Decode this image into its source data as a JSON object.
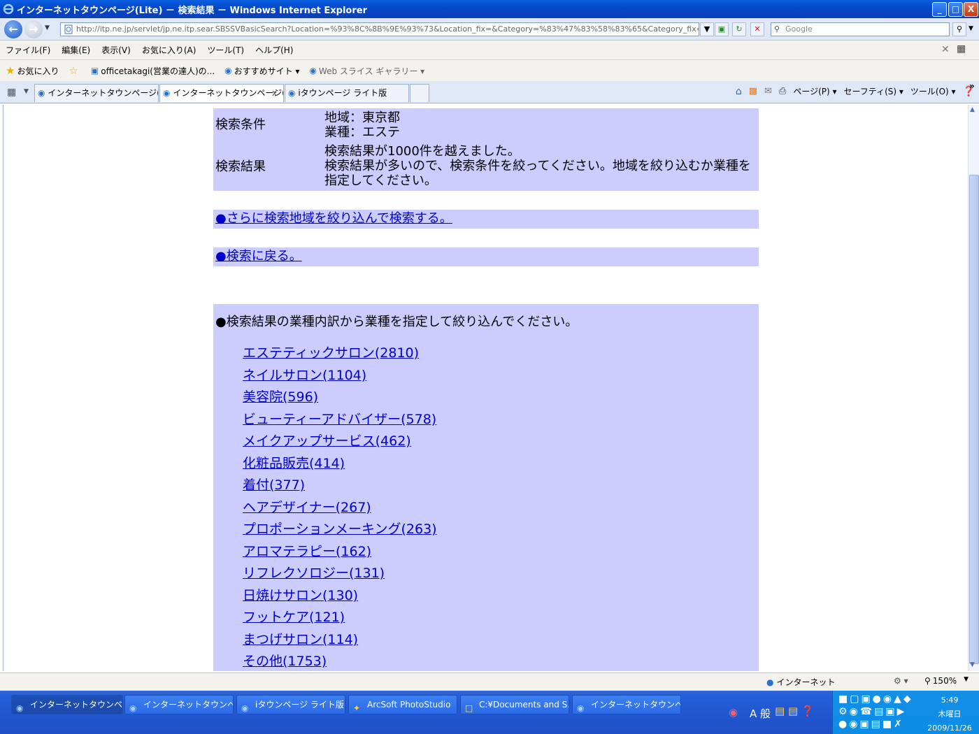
{
  "window": {
    "title": "インターネットタウンページ(Lite) － 検索結果 － Windows Internet Explorer",
    "btn_min": "_",
    "btn_max": "□",
    "btn_close": "X"
  },
  "address": {
    "url": "http://itp.ne.jp/servlet/jp.ne.itp.sear.SBSSVBasicSearch?Location=%93%8C%8B%9E%93%73&Location_fix=&Category=%83%47%83%58%83%65&Category_fix=&free_word=&Name=&s",
    "search_placeholder": "Google"
  },
  "menu": [
    "ファイル(F)",
    "編集(E)",
    "表示(V)",
    "お気に入り(A)",
    "ツール(T)",
    "ヘルプ(H)"
  ],
  "favorites": {
    "label": "お気に入り",
    "items": [
      "officetakagi(営業の達人)の...",
      "おすすめサイト ▾",
      "Web スライス ギャラリー ▾"
    ]
  },
  "tabs": [
    {
      "label": "インターネットタウンページ(Lit..."
    },
    {
      "label": "インターネットタウンページ(...",
      "close": "x"
    },
    {
      "label": "iタウンページ ライト版"
    }
  ],
  "commandbar": [
    "ページ(P) ▾",
    "セーフティ(S) ▾",
    "ツール(O) ▾"
  ],
  "page": {
    "cond_label": "検索条件",
    "cond_area": "地域：東京都",
    "cond_category": "業種：エステ",
    "result_label": "検索結果",
    "result_line1": "検索結果が1000件を越えました。",
    "result_line2": "検索結果が多いので、検索条件を絞ってください。地域を絞り込むか業種を指定してください。",
    "narrow_area_link": "●さらに検索地域を絞り込んで検索する。",
    "back_link": "●検索に戻る。",
    "categories_heading": "●検索結果の業種内訳から業種を指定して絞り込んでください。",
    "categories": [
      "エステティックサロン(2810)",
      "ネイルサロン(1104)",
      "美容院(596)",
      "ビューティーアドバイザー(578)",
      "メイクアップサービス(462)",
      "化粧品販売(414)",
      "着付(377)",
      "ヘアデザイナー(267)",
      "プロポーションメーキング(263)",
      "アロマテラピー(162)",
      "リフレクソロジー(131)",
      "日焼けサロン(130)",
      "フットケア(121)",
      "まつげサロン(114)",
      "その他(1753)"
    ]
  },
  "status": {
    "zone": "インターネット",
    "zoom": "150%"
  },
  "taskbar": {
    "tasks": [
      "インターネットタウンペー...",
      "インターネットタウンペー...",
      "iタウンページ ライト版 -...",
      "ArcSoft PhotoStudio",
      "C:¥Documents and S...",
      "インターネットタウンペー..."
    ],
    "ime": "A 般",
    "clock_time": "5:49",
    "clock_day": "木曜日",
    "clock_date": "2009/11/26"
  }
}
